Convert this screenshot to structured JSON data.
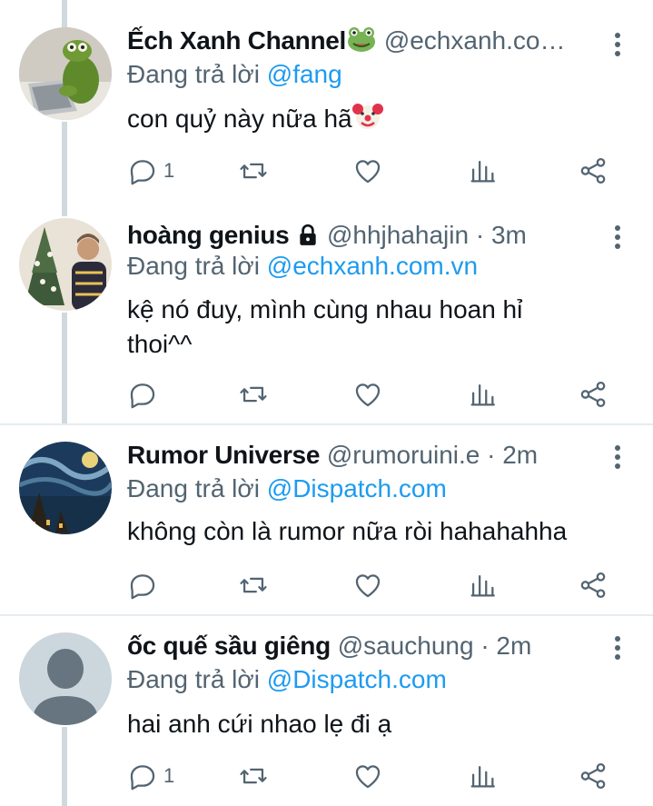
{
  "tweets": [
    {
      "name": "Ếch Xanh Channel",
      "badge": "frog-emoji",
      "handle": "@echxanh.co…",
      "time": "",
      "reply_label": "Đang trả lời",
      "reply_to": "@fang",
      "text": "con quỷ này nữa hã",
      "text_emoji": "clown-emoji",
      "reply_count": "1"
    },
    {
      "name": "hoàng genius",
      "badge": "lock-icon",
      "handle": "@hhjhahajin · 3m",
      "time": "",
      "reply_label": "Đang trả lời",
      "reply_to": "@echxanh.com.vn",
      "text": "kệ nó đuy, mình cùng nhau hoan hỉ thoi^^",
      "reply_count": ""
    },
    {
      "name": "Rumor Universe",
      "handle": "@rumoruini.e · 2m",
      "reply_label": "Đang trả lời",
      "reply_to": "@Dispatch.com",
      "text": "không còn là rumor nữa ròi hahahahha",
      "reply_count": ""
    },
    {
      "name": "ốc quế sầu giêng",
      "handle": "@sauchung · 2m",
      "reply_label": "Đang trả lời",
      "reply_to": "@Dispatch.com",
      "text": "hai anh cứi nhao lẹ đi ạ",
      "reply_count": "1"
    }
  ],
  "colors": {
    "link": "#1d9bf0",
    "muted": "#536471",
    "text": "#0f1419",
    "divider": "#e6ecf0"
  }
}
